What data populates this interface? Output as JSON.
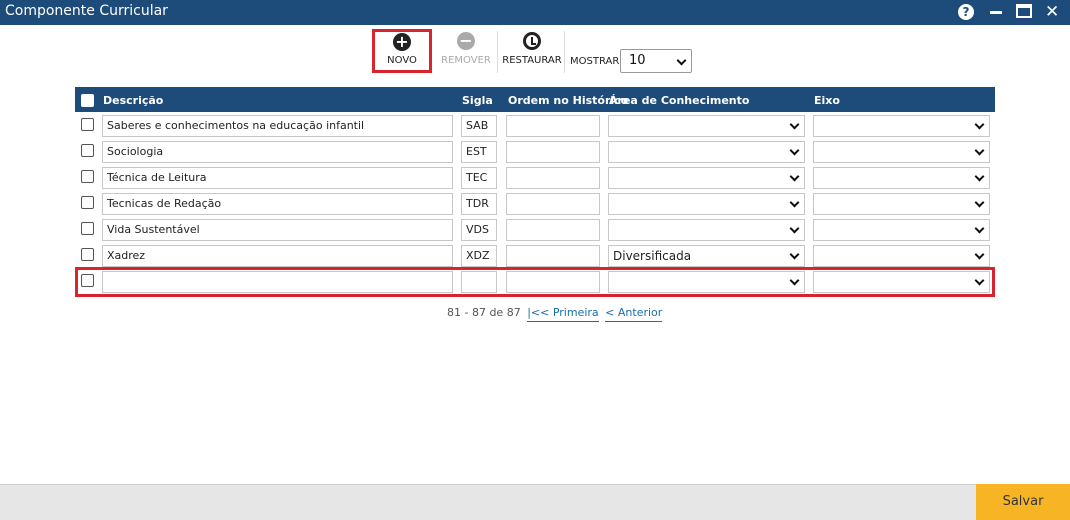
{
  "window": {
    "title": "Componente Curricular",
    "help_glyph": "?",
    "close_glyph": "✕"
  },
  "toolbar": {
    "novo_label": "NOVO",
    "remover_label": "REMOVER",
    "restaurar_label": "RESTAURAR",
    "mostrar_label": "MOSTRAR:",
    "mostrar_value": "10",
    "novo_icon": "plus-circle-icon",
    "remover_icon": "minus-circle-icon",
    "restaurar_icon": "restore-icon"
  },
  "grid": {
    "columns": {
      "descricao": "Descrição",
      "sigla": "Sigla",
      "ordem": "Ordem no Histórico",
      "area": "Área de Conhecimento",
      "eixo": "Eixo"
    },
    "rows": [
      {
        "descricao": "Saberes e conhecimentos na educação infantil",
        "sigla": "SAB",
        "ordem": "",
        "area": "",
        "eixo": ""
      },
      {
        "descricao": "Sociologia",
        "sigla": "EST",
        "ordem": "",
        "area": "",
        "eixo": ""
      },
      {
        "descricao": "Técnica de Leitura",
        "sigla": "TEC",
        "ordem": "",
        "area": "",
        "eixo": ""
      },
      {
        "descricao": "Tecnicas de Redação",
        "sigla": "TDR",
        "ordem": "",
        "area": "",
        "eixo": ""
      },
      {
        "descricao": "Vida Sustentável",
        "sigla": "VDS",
        "ordem": "",
        "area": "",
        "eixo": ""
      },
      {
        "descricao": "Xadrez",
        "sigla": "XDZ",
        "ordem": "",
        "area": "Diversificada",
        "eixo": ""
      },
      {
        "descricao": "",
        "sigla": "",
        "ordem": "",
        "area": "",
        "eixo": ""
      }
    ]
  },
  "pager": {
    "range": "81 - 87 de 87",
    "first": "|<< Primeira",
    "previous": "< Anterior"
  },
  "footer": {
    "save_label": "Salvar"
  },
  "colors": {
    "header_blue": "#1e4c7a",
    "highlight_red": "#d9232d",
    "save_orange": "#f7b526"
  }
}
